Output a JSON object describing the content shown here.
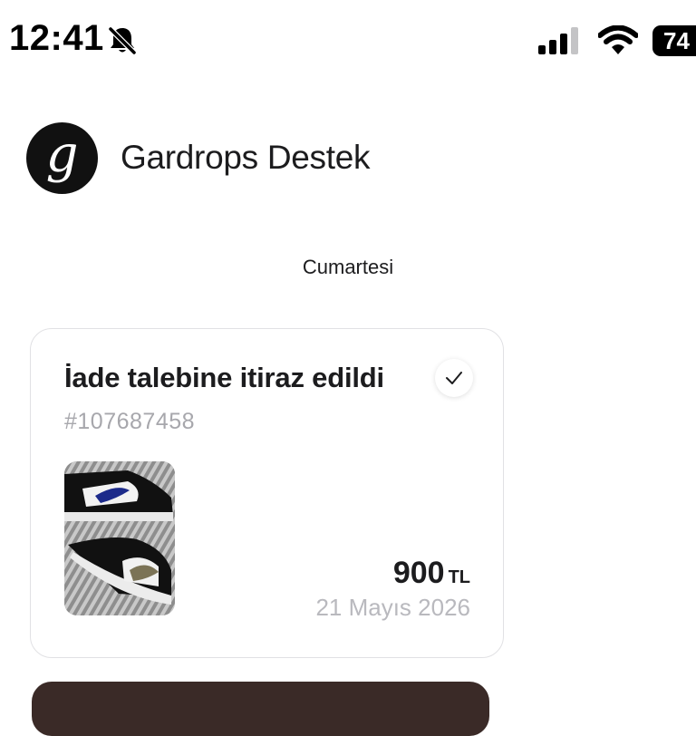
{
  "status_bar": {
    "time": "12:41",
    "battery": "74",
    "icons": [
      "bell-slash-icon",
      "cellular-signal-icon",
      "wifi-icon",
      "battery-icon"
    ]
  },
  "header": {
    "avatar_letter": "g",
    "title": "Gardrops Destek"
  },
  "day_label": "Cumartesi",
  "card": {
    "title": "İade talebine itiraz edildi",
    "order_number": "#107687458",
    "price": "900",
    "currency": "TL",
    "date": "21 Mayıs 2026",
    "check_icon": "checkmark-icon"
  },
  "colors": {
    "text": "#1c1c1e",
    "muted": "#a7a7ac",
    "avatar_bg": "#111111",
    "card_border": "#e1e1e4"
  }
}
